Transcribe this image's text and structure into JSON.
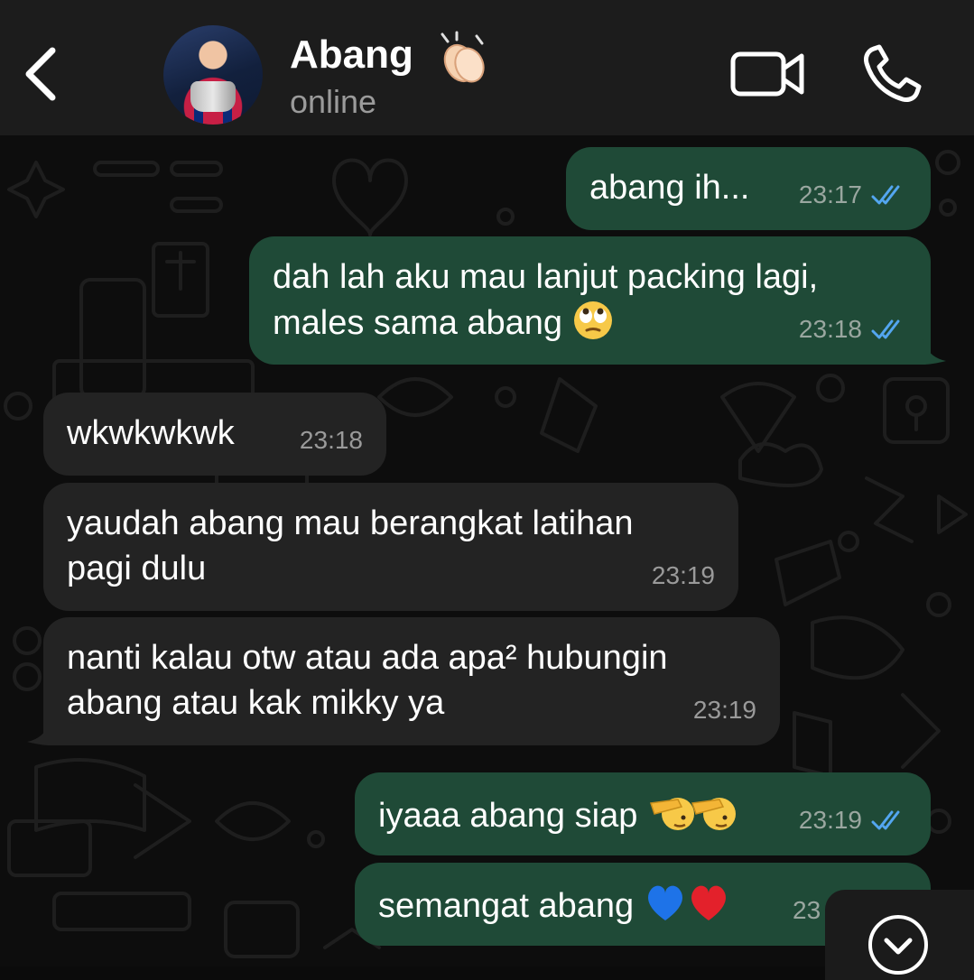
{
  "header": {
    "back_label": "<",
    "contact_name": "Abang",
    "name_emoji": "clapping-hands",
    "status": "online",
    "actions": [
      "video-call",
      "voice-call"
    ]
  },
  "messages": [
    {
      "direction": "outgoing",
      "text": "abang ih...",
      "time": "23:17",
      "ticks": "read"
    },
    {
      "direction": "outgoing",
      "line1": "dah lah aku mau lanjut packing lagi,",
      "line2": "males sama abang",
      "emoji": "face-with-rolling-eyes",
      "time": "23:18",
      "ticks": "read"
    },
    {
      "direction": "incoming",
      "text": "wkwkwkwk",
      "time": "23:18"
    },
    {
      "direction": "incoming",
      "line1": "yaudah abang mau berangkat latihan",
      "line2": "pagi dulu",
      "time": "23:19"
    },
    {
      "direction": "incoming",
      "line1": "nanti kalau otw atau ada apa² hubungin",
      "line2": "abang atau kak mikky ya",
      "time": "23:19"
    },
    {
      "direction": "outgoing",
      "text": "iyaaa abang siap",
      "emoji": "saluting-face x2",
      "time": "23:19",
      "ticks": "read"
    },
    {
      "direction": "outgoing",
      "text": "semangat abang",
      "emoji": "blue-heart, red-heart",
      "time": "23",
      "ticks": "read"
    }
  ],
  "colors": {
    "header_bg": "#1c1c1c",
    "outgoing_bubble": "#1f4a37",
    "incoming_bubble": "#232323",
    "read_ticks": "#53a6f0",
    "status_text": "#9b9b9b"
  },
  "scroll_down_icon": "chevron-down-circle-icon"
}
